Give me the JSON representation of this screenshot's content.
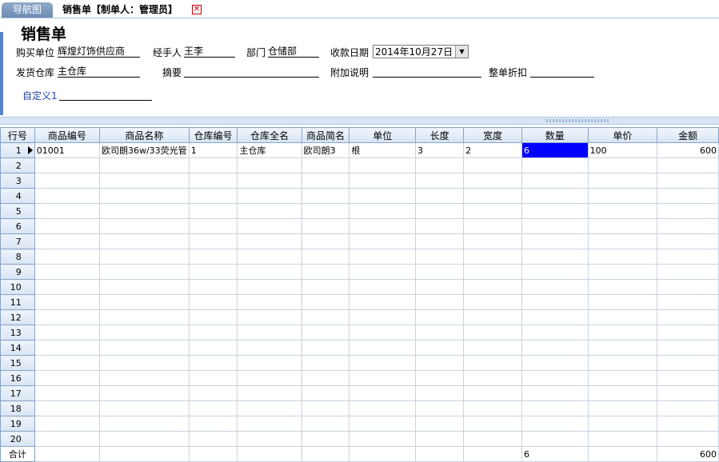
{
  "tabs": {
    "nav_label": "导航图",
    "active_label": "销售单【制单人：管理员】"
  },
  "form": {
    "title": "销售单",
    "buyer_label": "购买单位",
    "buyer_value": "辉煌灯饰供应商",
    "handler_label": "经手人",
    "handler_value": "王李",
    "dept_label": "部门",
    "dept_value": "仓储部",
    "date_label": "收款日期",
    "date_value": "2014年10月27日",
    "warehouse_label": "发货仓库",
    "warehouse_value": "主仓库",
    "summary_label": "摘要",
    "summary_value": "",
    "note_label": "附加说明",
    "note_value": "",
    "discount_label": "整单折扣",
    "discount_value": "",
    "custom1_label": "自定义1",
    "custom1_value": ""
  },
  "grid": {
    "columns": [
      "行号",
      "商品编号",
      "商品名称",
      "仓库编号",
      "仓库全名",
      "商品简名",
      "单位",
      "长度",
      "宽度",
      "数量",
      "单价",
      "金额"
    ],
    "rows": [
      {
        "no": "1",
        "code": "01001",
        "name": "欧司朗36w/33荧光管",
        "wh_code": "1",
        "wh_name": "主仓库",
        "short": "欧司朗3",
        "unit": "根",
        "length": "3",
        "width": "2",
        "qty": "6",
        "price": "100",
        "amount": "600"
      },
      {
        "no": "2"
      },
      {
        "no": "3"
      },
      {
        "no": "4"
      },
      {
        "no": "5"
      },
      {
        "no": "6"
      },
      {
        "no": "7"
      },
      {
        "no": "8"
      },
      {
        "no": "9"
      },
      {
        "no": "10"
      },
      {
        "no": "11"
      },
      {
        "no": "12"
      },
      {
        "no": "13"
      },
      {
        "no": "14"
      },
      {
        "no": "15"
      },
      {
        "no": "16"
      },
      {
        "no": "17"
      },
      {
        "no": "18"
      },
      {
        "no": "19"
      },
      {
        "no": "20"
      }
    ],
    "total": {
      "label": "合计",
      "qty": "6",
      "amount": "600"
    }
  },
  "colors": {
    "selected_cell": "#0000ff",
    "accent": "#5a82c8"
  }
}
